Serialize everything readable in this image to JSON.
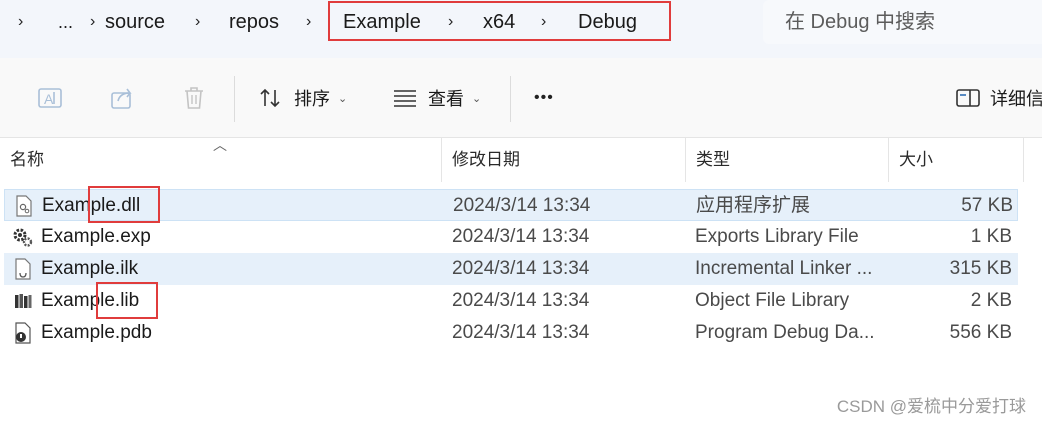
{
  "breadcrumb": {
    "items": [
      "...",
      "source",
      "repos",
      "Example",
      "x64",
      "Debug"
    ],
    "separator": "›"
  },
  "search": {
    "placeholder": "在 Debug 中搜索"
  },
  "toolbar": {
    "rename_icon": "rename-icon",
    "share_icon": "share-icon",
    "delete_icon": "trash-icon",
    "sort_label": "排序",
    "view_label": "查看",
    "more_label": "•••",
    "details_label": "详细信"
  },
  "columns": {
    "name": "名称",
    "date": "修改日期",
    "type": "类型",
    "size": "大小"
  },
  "files": [
    {
      "name": "Example.dll",
      "date": "2024/3/14 13:34",
      "type": "应用程序扩展",
      "size": "57 KB",
      "icon": "dll-file-icon"
    },
    {
      "name": "Example.exp",
      "date": "2024/3/14 13:34",
      "type": "Exports Library File",
      "size": "1 KB",
      "icon": "gear-file-icon"
    },
    {
      "name": "Example.ilk",
      "date": "2024/3/14 13:34",
      "type": "Incremental Linker ...",
      "size": "315 KB",
      "icon": "linker-file-icon"
    },
    {
      "name": "Example.lib",
      "date": "2024/3/14 13:34",
      "type": "Object File Library",
      "size": "2 KB",
      "icon": "library-file-icon"
    },
    {
      "name": "Example.pdb",
      "date": "2024/3/14 13:34",
      "type": "Program Debug Da...",
      "size": "556 KB",
      "icon": "debug-file-icon"
    }
  ],
  "watermark": "CSDN @爱梳中分爱打球",
  "colors": {
    "highlight": "#e03c3c",
    "selection": "#e6f0fa"
  }
}
